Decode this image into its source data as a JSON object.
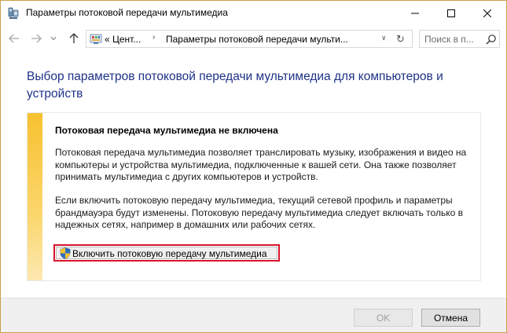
{
  "window": {
    "title": "Параметры потоковой передачи мультимедиа",
    "app_icon": "media-streaming-icon",
    "controls": [
      "minimize-icon",
      "maximize-icon",
      "close-icon"
    ]
  },
  "navigation": {
    "back_icon": "arrow-left-icon",
    "forward_icon": "arrow-right-icon",
    "recent_icon": "chevron-down-icon",
    "up_icon": "arrow-up-icon",
    "breadcrumb": {
      "icon": "control-panel-icon",
      "items": [
        "« Цент...",
        "Параметры потоковой передачи мульти..."
      ]
    },
    "refresh_icon": "refresh-icon",
    "search_placeholder": "Поиск в п..."
  },
  "main": {
    "heading": "Выбор параметров потоковой передачи мультимедиа для компьютеров и устройств",
    "infobox": {
      "accent_color": "#f7c12f",
      "title": "Потоковая передача мультимедиа не включена",
      "paragraph1": "Потоковая передача мультимедиа позволяет транслировать музыку, изображения и видео на компьютеры и устройства мультимедиа, подключенные к вашей сети. Она также позволяет принимать мультимедиа с других компьютеров и устройств.",
      "paragraph2": "Если включить потоковую передачу мультимедиа, текущий сетевой профиль и параметры брандмауэра будут изменены. Потоковую передачу мультимедиа следует включать только в надежных сетях, например в домашних или рабочих сетях.",
      "enable_button": "Включить потоковую передачу мультимедиа",
      "enable_icon": "uac-shield-icon",
      "highlight_color": "#d8132b"
    }
  },
  "footer": {
    "ok_label": "OK",
    "cancel_label": "Отмена"
  }
}
